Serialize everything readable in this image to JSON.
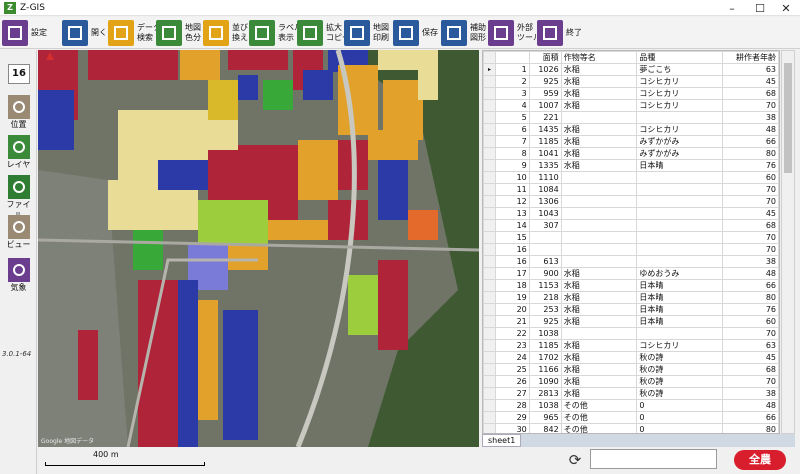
{
  "window": {
    "title": "Z-GIS",
    "icon": "z-gis-app-icon",
    "minimize": "–",
    "maximize": "☐",
    "close": "✕"
  },
  "toolbar": [
    {
      "id": "settings",
      "label": "設定",
      "icon": "gear-icon",
      "color": "#6b3d8f"
    },
    {
      "id": "open",
      "label": "開く",
      "icon": "folder-icon",
      "color": "#2b5a9c"
    },
    {
      "id": "data-search",
      "label": "データ\n検索",
      "icon": "magnifier-icon",
      "color": "#e2a317"
    },
    {
      "id": "map-color",
      "label": "地図\n色分",
      "icon": "paint-roller-icon",
      "color": "#3a8a3a"
    },
    {
      "id": "sort",
      "label": "並び\n換え",
      "icon": "sort-icon",
      "color": "#e2a317"
    },
    {
      "id": "label-display",
      "label": "ラベル\n表示",
      "icon": "label-arrow-icon",
      "color": "#3a8a3a"
    },
    {
      "id": "enlarge-copy",
      "label": "拡大\nコピー",
      "icon": "expand-icon",
      "color": "#3a8a3a"
    },
    {
      "id": "map-print",
      "label": "地図\n印刷",
      "icon": "printer-icon",
      "color": "#2b5a9c"
    },
    {
      "id": "save",
      "label": "保存",
      "icon": "floppy-icon",
      "color": "#2b5a9c"
    },
    {
      "id": "aux-shape",
      "label": "補助\n図形",
      "icon": "draw-shape-icon",
      "color": "#2b5a9c"
    },
    {
      "id": "external-tool",
      "label": "外部\nツール",
      "icon": "tools-icon",
      "color": "#6b3d8f"
    },
    {
      "id": "exit",
      "label": "終了",
      "icon": "exit-icon",
      "color": "#6b3d8f"
    }
  ],
  "leftbar": {
    "zoom": "16",
    "buttons": [
      {
        "id": "position",
        "label": "位置",
        "icon": "location-icon",
        "color": "#9a8a74"
      },
      {
        "id": "layer",
        "label": "レイヤ",
        "icon": "layers-icon",
        "color": "#3a8a3a"
      },
      {
        "id": "file",
        "label": "ファイル",
        "icon": "excel-file-icon",
        "color": "#2e7d32"
      },
      {
        "id": "view",
        "label": "ビュー",
        "icon": "eye-icon",
        "color": "#9a8a74"
      },
      {
        "id": "weather",
        "label": "気象",
        "icon": "thermometer-icon",
        "color": "#6b3d8f"
      }
    ],
    "version": "3.0.1-64"
  },
  "map": {
    "attribution": "Google 地図データ",
    "scale_label": "400 m"
  },
  "grid": {
    "columns": [
      "",
      "面積",
      "作物等名",
      "品種",
      "耕作者年齢"
    ],
    "rows": [
      [
        "1",
        "1026",
        "水稲",
        "夢ごこち",
        "63"
      ],
      [
        "2",
        "925",
        "水稲",
        "コシヒカリ",
        "45"
      ],
      [
        "3",
        "959",
        "水稲",
        "コシヒカリ",
        "68"
      ],
      [
        "4",
        "1007",
        "水稲",
        "コシヒカリ",
        "70"
      ],
      [
        "5",
        "221",
        "",
        "",
        "38"
      ],
      [
        "6",
        "1435",
        "水稲",
        "コシヒカリ",
        "48"
      ],
      [
        "7",
        "1185",
        "水稲",
        "みずかがみ",
        "66"
      ],
      [
        "8",
        "1041",
        "水稲",
        "みずかがみ",
        "80"
      ],
      [
        "9",
        "1335",
        "水稲",
        "日本晴",
        "76"
      ],
      [
        "10",
        "1110",
        "",
        "",
        "60"
      ],
      [
        "11",
        "1084",
        "",
        "",
        "70"
      ],
      [
        "12",
        "1306",
        "",
        "",
        "70"
      ],
      [
        "13",
        "1043",
        "",
        "",
        "45"
      ],
      [
        "14",
        "307",
        "",
        "",
        "68"
      ],
      [
        "15",
        "",
        "",
        "",
        "70"
      ],
      [
        "16",
        "",
        "",
        "",
        "70"
      ],
      [
        "16",
        "613",
        "",
        "",
        "38"
      ],
      [
        "17",
        "900",
        "水稲",
        "ゆめおうみ",
        "48"
      ],
      [
        "18",
        "1153",
        "水稲",
        "日本晴",
        "66"
      ],
      [
        "19",
        "218",
        "水稲",
        "日本晴",
        "80"
      ],
      [
        "20",
        "253",
        "水稲",
        "日本晴",
        "76"
      ],
      [
        "21",
        "925",
        "水稲",
        "日本晴",
        "60"
      ],
      [
        "22",
        "1038",
        "",
        "",
        "70"
      ],
      [
        "23",
        "1185",
        "水稲",
        "コシヒカリ",
        "63"
      ],
      [
        "24",
        "1702",
        "水稲",
        "秋の詩",
        "45"
      ],
      [
        "25",
        "1166",
        "水稲",
        "秋の詩",
        "68"
      ],
      [
        "26",
        "1090",
        "水稲",
        "秋の詩",
        "70"
      ],
      [
        "27",
        "2813",
        "水稲",
        "秋の詩",
        "38"
      ],
      [
        "28",
        "1038",
        "その他",
        "0",
        "48"
      ],
      [
        "29",
        "965",
        "その他",
        "0",
        "66"
      ],
      [
        "30",
        "842",
        "その他",
        "0",
        "80"
      ]
    ]
  },
  "sheet_tab": "sheet1",
  "brand": "全農",
  "refresh_icon": "refresh-icon"
}
